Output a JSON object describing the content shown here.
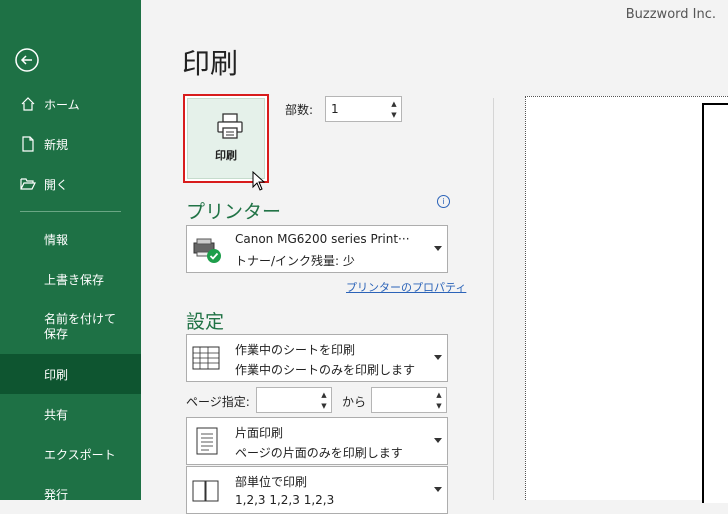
{
  "watermark": "Buzzword Inc.",
  "sidebar": {
    "items": [
      {
        "label": "ホーム",
        "icon": "home-icon"
      },
      {
        "label": "新規",
        "icon": "new-document-icon"
      },
      {
        "label": "開く",
        "icon": "open-folder-icon"
      },
      {
        "label": "情報"
      },
      {
        "label": "上書き保存"
      },
      {
        "label": "名前を付けて保存"
      },
      {
        "label": "印刷"
      },
      {
        "label": "共有"
      },
      {
        "label": "エクスポート"
      },
      {
        "label": "発行"
      }
    ],
    "selected": "印刷",
    "accent": "#1e7145",
    "selected_bg": "#0e5530"
  },
  "main": {
    "title": "印刷",
    "print_button": {
      "label": "印刷",
      "icon": "printer-icon"
    },
    "copies": {
      "label": "部数:",
      "value": "1"
    },
    "printer": {
      "heading": "プリンター",
      "name": "Canon MG6200 series Print···",
      "status": "トナー/インク残量: 少",
      "icon": "printer-ready-icon",
      "properties_link": "プリンターのプロパティ"
    },
    "settings": {
      "heading": "設定",
      "what_to_print": {
        "line1": "作業中のシートを印刷",
        "line2": "作業中のシートのみを印刷します",
        "icon": "sheet-grid-icon"
      },
      "pages": {
        "label": "ページ指定:",
        "between": "から",
        "from": "",
        "to": ""
      },
      "sides": {
        "line1": "片面印刷",
        "line2": "ページの片面のみを印刷します",
        "icon": "one-sided-page-icon"
      },
      "collate": {
        "line1": "部単位で印刷",
        "line2": "1,2,3   1,2,3   1,2,3",
        "icon": "collated-pages-icon"
      }
    }
  }
}
